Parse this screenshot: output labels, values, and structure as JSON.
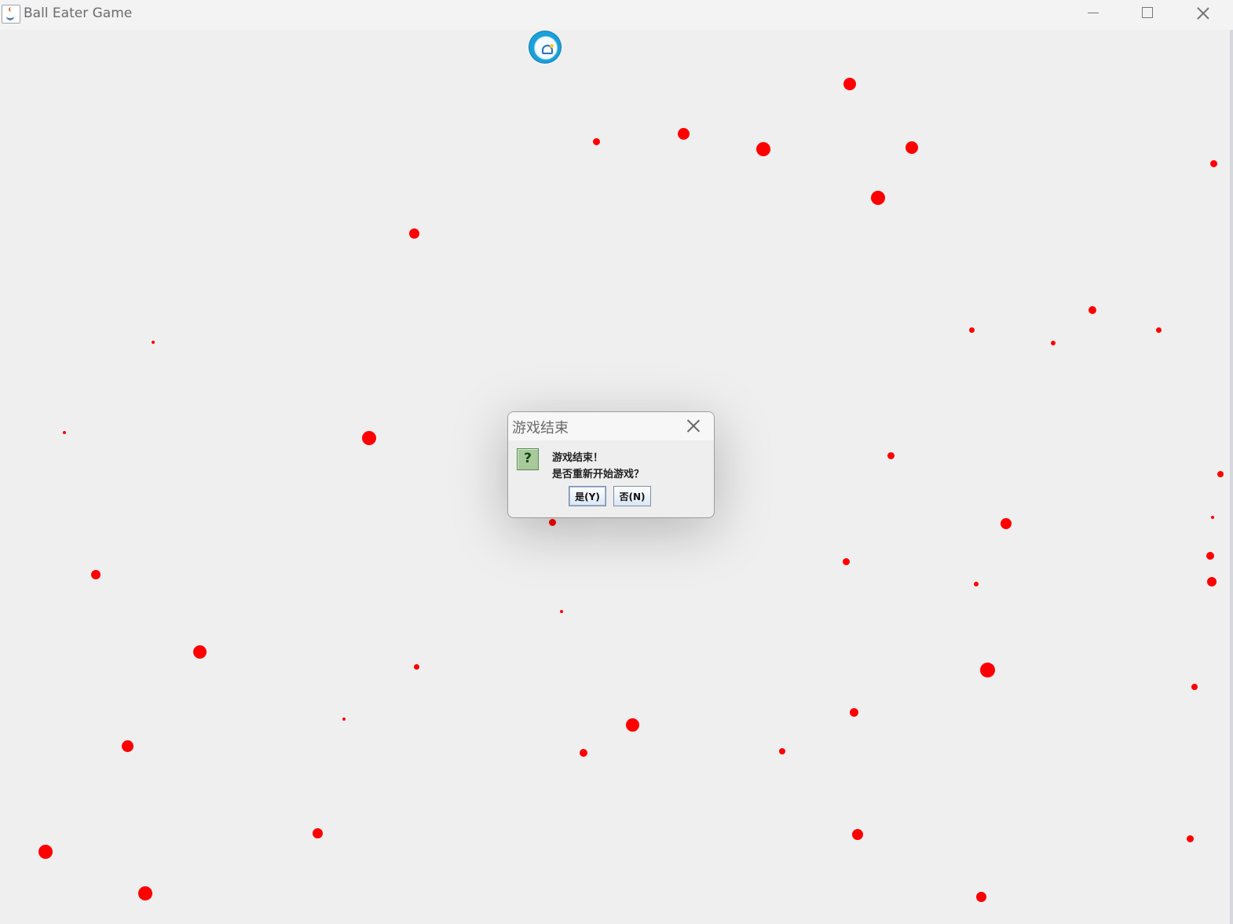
{
  "window": {
    "title": "Ball Eater Game"
  },
  "dialog": {
    "title": "游戏结束",
    "message": [
      "游戏结束！",
      "是否重新开始游戏？"
    ],
    "yes_label": "是(Y)",
    "no_label": "否(N)",
    "icon": "question-icon"
  },
  "game": {
    "player_icon": "player-ball-icon",
    "ball_color": "#ff0000",
    "background_color": "#efefef"
  }
}
